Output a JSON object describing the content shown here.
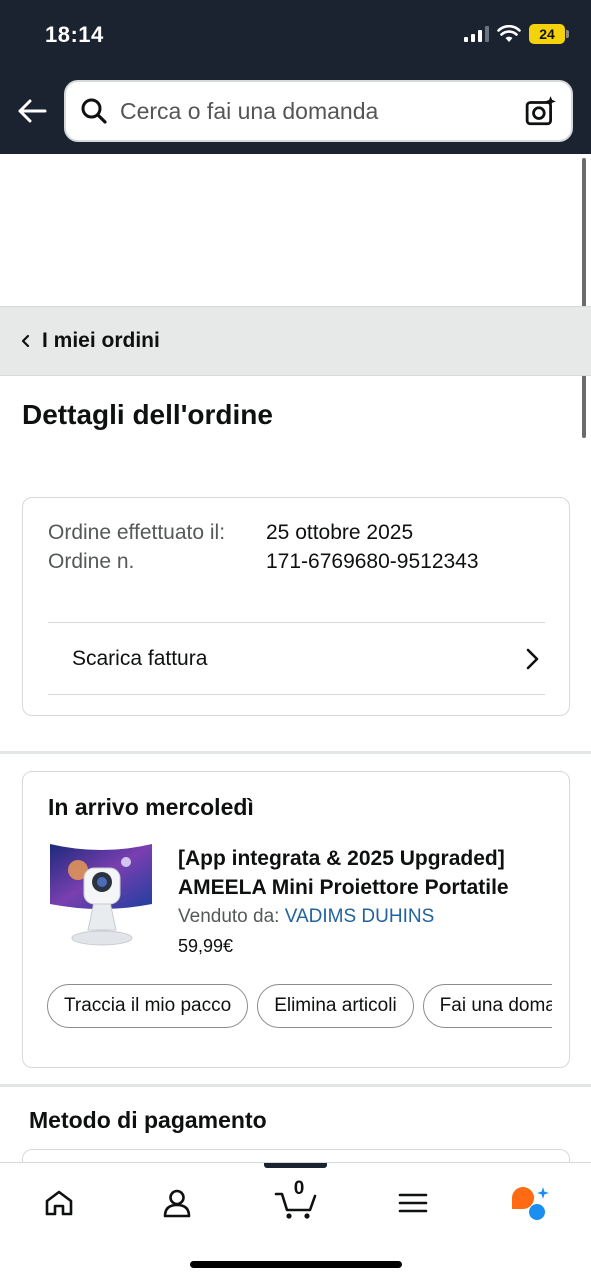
{
  "status_bar": {
    "time": "18:14",
    "battery": "24"
  },
  "search": {
    "placeholder": "Cerca o fai una domanda"
  },
  "breadcrumb": {
    "label": "I miei ordini"
  },
  "page": {
    "title": "Dettagli dell'ordine"
  },
  "order": {
    "placed_label": "Ordine effettuato il:",
    "number_label": "Ordine n.",
    "placed_date": "25 ottobre 2025",
    "order_number": "171-6769680-9512343",
    "invoice_label": "Scarica fattura"
  },
  "delivery": {
    "title": "In arrivo mercoledì",
    "product_title": "[App integrata & 2025 Upgraded] AMEELA Mini Proiettore Portatile",
    "sold_by_label": "Venduto da:",
    "seller": "VADIMS DUHINS",
    "price": "59,99€",
    "actions": [
      "Traccia il mio pacco",
      "Elimina articoli",
      "Fai una domanda"
    ]
  },
  "payment": {
    "title": "Metodo di pagamento"
  },
  "bottom_nav": {
    "items": [
      "home-icon",
      "account-icon",
      "cart-icon",
      "menu-icon",
      "assistant-icon"
    ],
    "cart_count": "0"
  },
  "colors": {
    "header_bg": "#1b2330",
    "link": "#2162a1",
    "breadcrumb_bg": "#e7e8e8",
    "battery": "#f4d20c",
    "assistant_orange": "#ff6a13",
    "assistant_blue": "#1a8ff0"
  }
}
